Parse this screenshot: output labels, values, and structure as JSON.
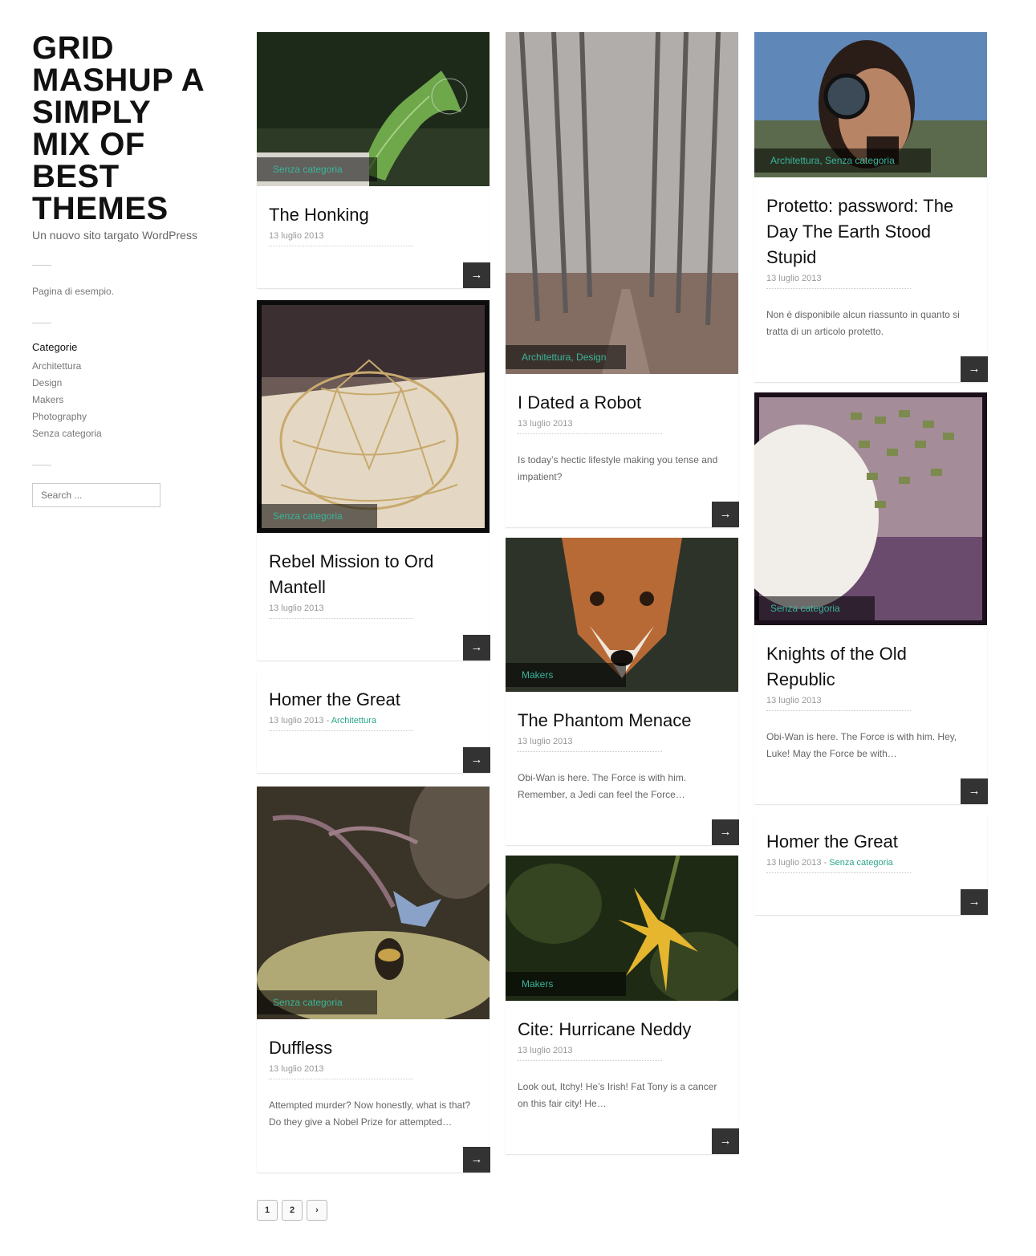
{
  "site": {
    "title": "GRID MASHUP A SIMPLY MIX OF BEST THEMES",
    "description": "Un nuovo sito targato WordPress"
  },
  "sidebar": {
    "page_link": "Pagina di esempio.",
    "categories_title": "Categorie",
    "categories": [
      "Architettura",
      "Design",
      "Makers",
      "Photography",
      "Senza categoria"
    ],
    "search_placeholder": "Search ..."
  },
  "posts": {
    "honking": {
      "category": "Senza categoria",
      "title": "The Honking",
      "date": "13 luglio 2013"
    },
    "rebel": {
      "category": "Senza categoria",
      "title": "Rebel Mission to Ord Mantell",
      "date": "13 luglio 2013"
    },
    "homer1": {
      "title": "Homer the Great",
      "date": "13 luglio 2013",
      "meta_sep": " - ",
      "category": "Architettura"
    },
    "duffless": {
      "category": "Senza categoria",
      "title": "Duffless",
      "date": "13 luglio 2013",
      "excerpt": "Attempted murder? Now honestly, what is that? Do they give a Nobel Prize for attempted…"
    },
    "robot": {
      "category": "Architettura, Design",
      "title": "I Dated a Robot",
      "date": "13 luglio 2013",
      "excerpt": "Is today’s hectic lifestyle making you tense and impatient?"
    },
    "phantom": {
      "category": "Makers",
      "title": "The Phantom Menace",
      "date": "13 luglio 2013",
      "excerpt": "Obi-Wan is here. The Force is with him. Remember, a Jedi can feel the Force…"
    },
    "neddy": {
      "category": "Makers",
      "title": "Cite: Hurricane Neddy",
      "date": "13 luglio 2013",
      "excerpt": "Look out, Itchy! He’s Irish! Fat Tony is a cancer on this fair city! He…"
    },
    "protetto": {
      "category": "Architettura, Senza categoria",
      "title": "Protetto: password: The Day The Earth Stood Stupid",
      "date": "13 luglio 2013",
      "excerpt": "Non è disponibile alcun riassunto in quanto si tratta di un articolo protetto."
    },
    "knights": {
      "category": "Senza categoria",
      "title": "Knights of the Old Republic",
      "date": "13 luglio 2013",
      "excerpt": "Obi-Wan is here. The Force is with him. Hey, Luke! May the Force be with…"
    },
    "homer2": {
      "title": "Homer the Great",
      "date": "13 luglio 2013",
      "meta_sep": " - ",
      "category": "Senza categoria"
    }
  },
  "arrow": "→",
  "pagination": {
    "pages": [
      "1",
      "2"
    ],
    "next": "›"
  }
}
